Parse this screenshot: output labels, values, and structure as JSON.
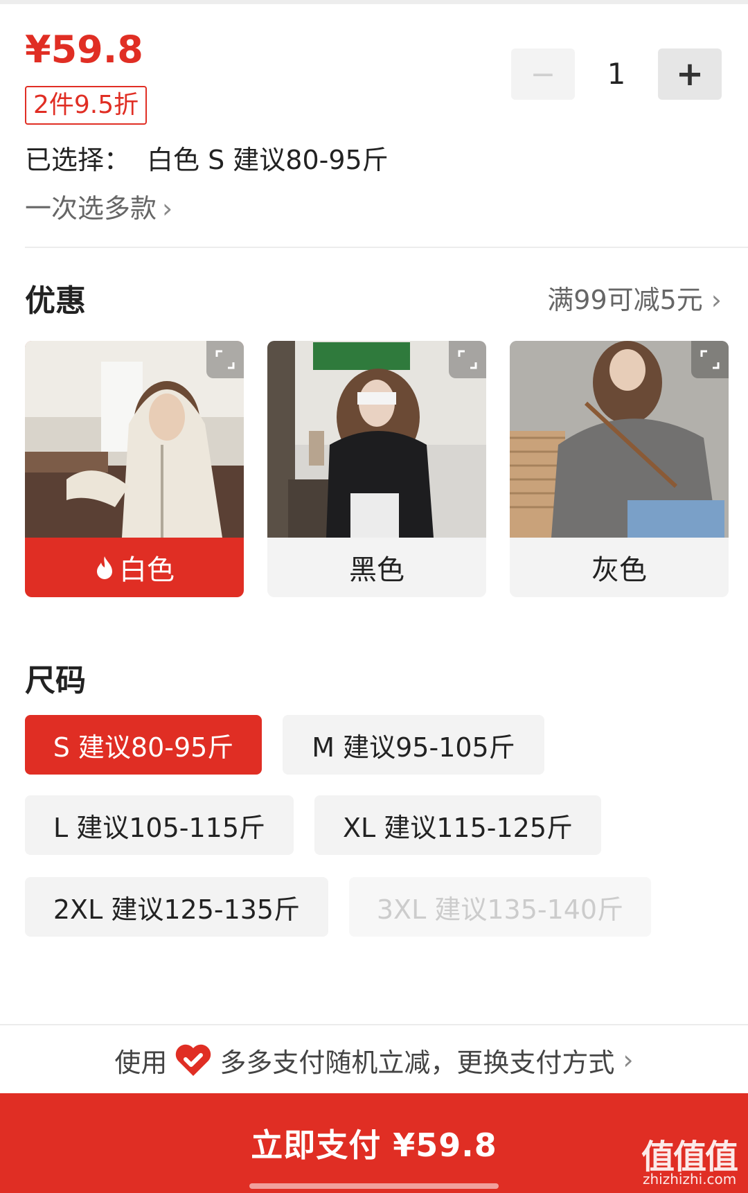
{
  "product": {
    "price": "¥59.8",
    "discount_badge": "2件9.5折",
    "selected_label": "已选择：",
    "selected_value": "白色 S 建议80-95斤",
    "multi_select_link": "一次选多款",
    "chevron": "›"
  },
  "quantity": {
    "minus_icon": "−",
    "value": "1",
    "plus_icon": "+"
  },
  "promotion": {
    "title": "优惠",
    "detail": "满99可减5元"
  },
  "colors": [
    {
      "label": "白色",
      "selected": true
    },
    {
      "label": "黑色",
      "selected": false
    },
    {
      "label": "灰色",
      "selected": false
    }
  ],
  "size_section": {
    "title": "尺码",
    "options": [
      {
        "label": "S 建议80-95斤",
        "state": "selected"
      },
      {
        "label": "M 建议95-105斤",
        "state": "normal"
      },
      {
        "label": "L 建议105-115斤",
        "state": "normal"
      },
      {
        "label": "XL 建议115-125斤",
        "state": "normal"
      },
      {
        "label": "2XL 建议125-135斤",
        "state": "normal"
      },
      {
        "label": "3XL 建议135-140斤",
        "state": "disabled"
      }
    ]
  },
  "payment": {
    "prefix": "使用",
    "method_text": "多多支付随机立减，更换支付方式",
    "button_label": "立即支付 ¥59.8"
  },
  "watermark": {
    "main": "值值值",
    "sub": "zhizhizhi.com"
  },
  "theme": {
    "accent": "#e02e24",
    "chip_bg": "#f3f3f3"
  }
}
